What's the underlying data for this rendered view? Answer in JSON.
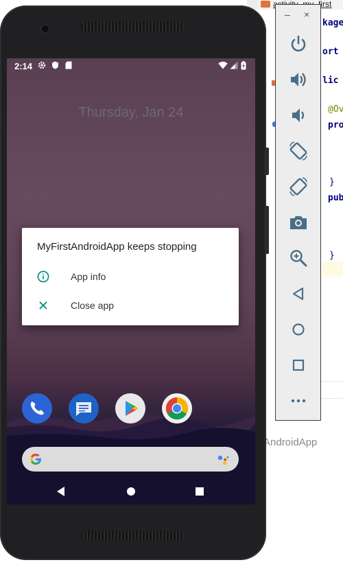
{
  "ide": {
    "tab_label": "activity_my_first",
    "code_lines": [
      {
        "text": "kage",
        "kind": "kw"
      },
      {
        "text": "ort",
        "kind": "kw"
      },
      {
        "text": "lic",
        "kind": "kw"
      },
      {
        "text": "@Ov",
        "kind": "ann"
      },
      {
        "text": "pro",
        "kind": "kw"
      },
      {
        "text": "}",
        "kind": "plain"
      },
      {
        "text": "pub",
        "kind": "kw"
      },
      {
        "text": "}",
        "kind": "plain"
      }
    ],
    "footer_text": "AndroidApp"
  },
  "phone": {
    "status_bar": {
      "time": "2:14"
    },
    "lockscreen": {
      "date": "Thursday, Jan 24"
    },
    "dialog": {
      "title": "MyFirstAndroidApp keeps stopping",
      "options": [
        {
          "label": "App info",
          "icon": "info-icon"
        },
        {
          "label": "Close app",
          "icon": "close-icon"
        }
      ],
      "accent_color": "#00897b"
    },
    "dock": [
      "phone-icon",
      "messages-icon",
      "play-store-icon",
      "chrome-icon"
    ],
    "search_bar": {
      "icon": "google-icon",
      "assistant_icon": "assistant-icon"
    },
    "nav_bar": [
      "back-icon",
      "home-icon",
      "recents-icon"
    ]
  },
  "emulator_toolbar": {
    "window_controls": {
      "minimize": "–",
      "close": "×"
    },
    "buttons": [
      "power-icon",
      "volume-up-icon",
      "volume-down-icon",
      "rotate-left-icon",
      "rotate-right-icon",
      "screenshot-icon",
      "zoom-icon",
      "back-icon",
      "home-icon",
      "overview-icon",
      "more-icon"
    ],
    "icon_color": "#4a6e88"
  }
}
